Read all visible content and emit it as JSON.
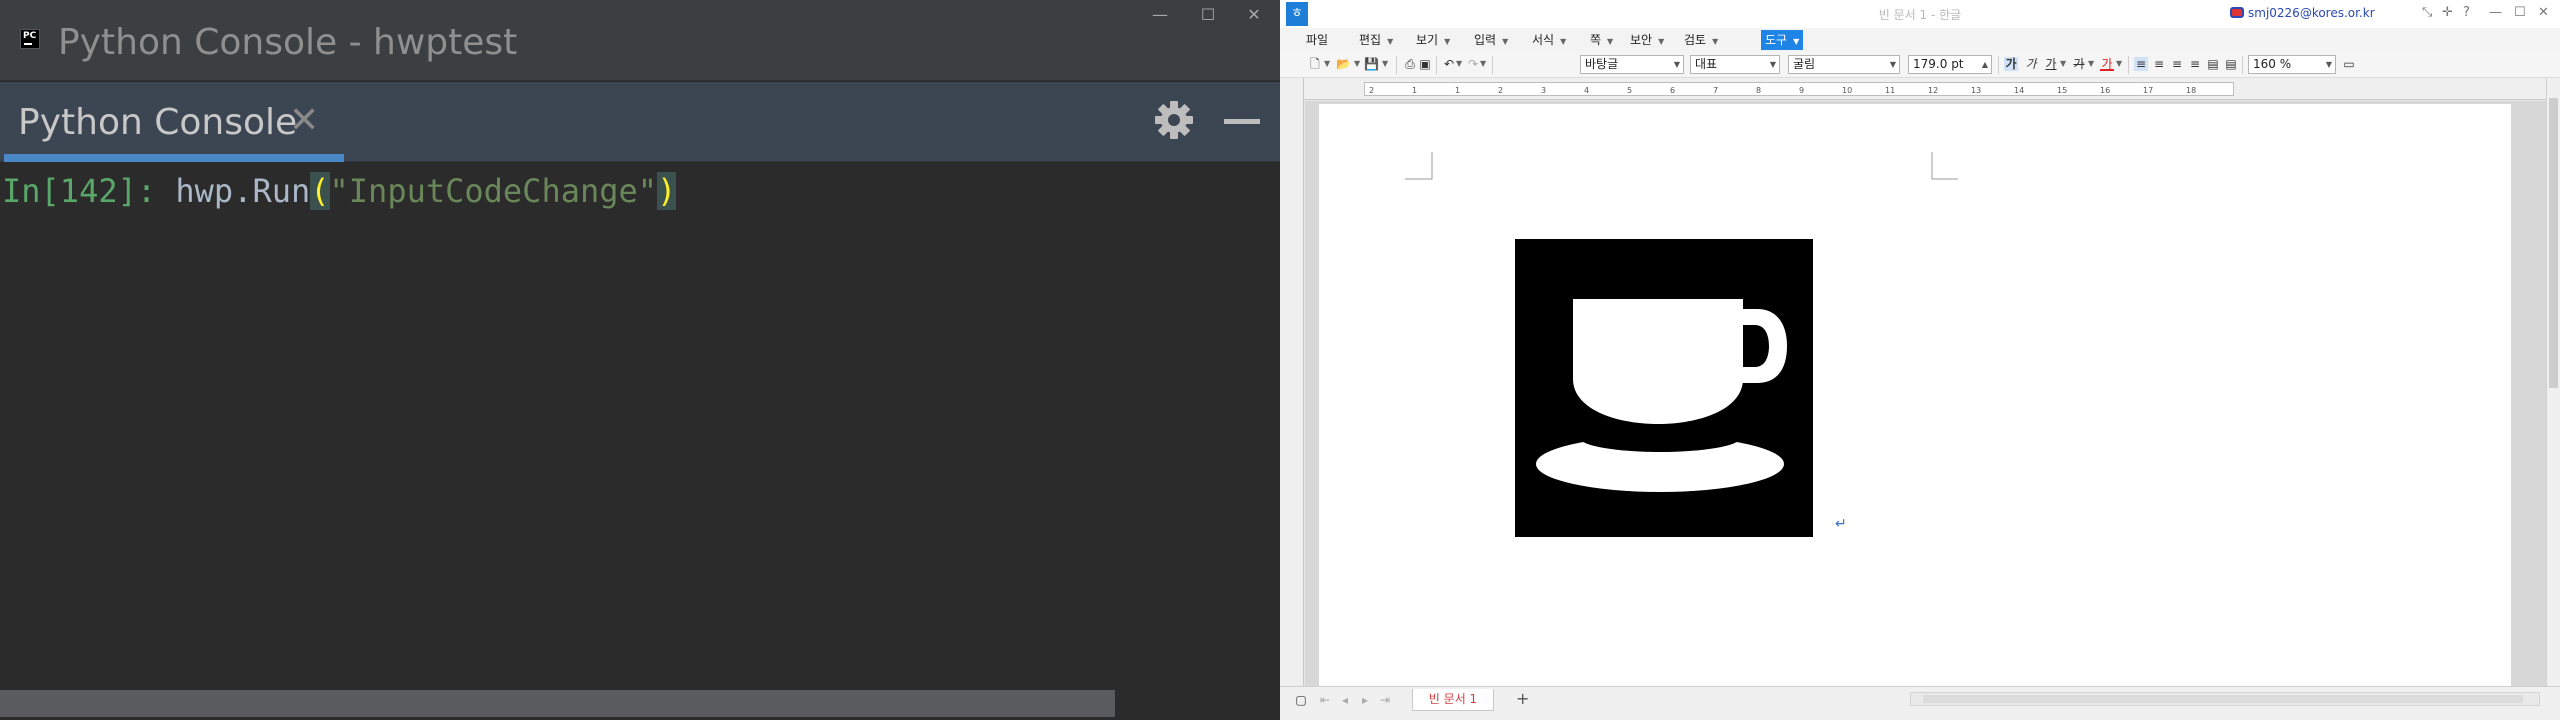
{
  "console": {
    "window_title": "Python Console - hwptest",
    "logo_text": "PC",
    "window_buttons": {
      "minimize": "—",
      "maximize": "☐",
      "close": "✕"
    },
    "tab_label": "Python Console",
    "tab_close": "✕",
    "input": {
      "prompt": "In[142]:",
      "object": "hwp.Run",
      "open_paren": "(",
      "argument": "\"InputCodeChange\"",
      "close_paren": ")"
    }
  },
  "hwp": {
    "window_title": "빈 문서 1 - 한글",
    "user": "smj0226@kores.or.kr",
    "title_buttons": [
      "⤡",
      "✛",
      "?",
      "—",
      "☐",
      "✕"
    ],
    "menu": [
      {
        "label": "파일",
        "active": false,
        "dropdown": false
      },
      {
        "label": "편집",
        "active": false,
        "dropdown": true
      },
      {
        "label": "보기",
        "active": false,
        "dropdown": true
      },
      {
        "label": "입력",
        "active": false,
        "dropdown": true
      },
      {
        "label": "서식",
        "active": false,
        "dropdown": true
      },
      {
        "label": "쪽",
        "active": false,
        "dropdown": true
      },
      {
        "label": "보안",
        "active": false,
        "dropdown": true
      },
      {
        "label": "검토",
        "active": false,
        "dropdown": true
      },
      {
        "label": "도구",
        "active": true,
        "dropdown": true
      }
    ],
    "toolbar": {
      "style": "바탕글",
      "language": "대표",
      "font": "굴림",
      "font_size": "179.0",
      "font_unit": "pt",
      "zoom": "160",
      "zoom_unit": "%",
      "bold": "가",
      "italic": "가",
      "underline": "가",
      "strike": "가",
      "font_color": "가"
    },
    "ruler_numbers": [
      "2",
      "1",
      "1",
      "2",
      "3",
      "4",
      "5",
      "6",
      "7",
      "8",
      "9",
      "10",
      "11",
      "12",
      "13",
      "14",
      "15",
      "16",
      "17",
      "18"
    ],
    "page_tab": "빈 문서 1",
    "add_tab": "+",
    "paragraph_mark": "↵",
    "picture": {
      "name": "coffee-cup-picture",
      "background": "#000000",
      "foreground": "#ffffff"
    },
    "colors": {
      "accent": "#1e84e5",
      "page_tab_text": "#d04040"
    }
  }
}
